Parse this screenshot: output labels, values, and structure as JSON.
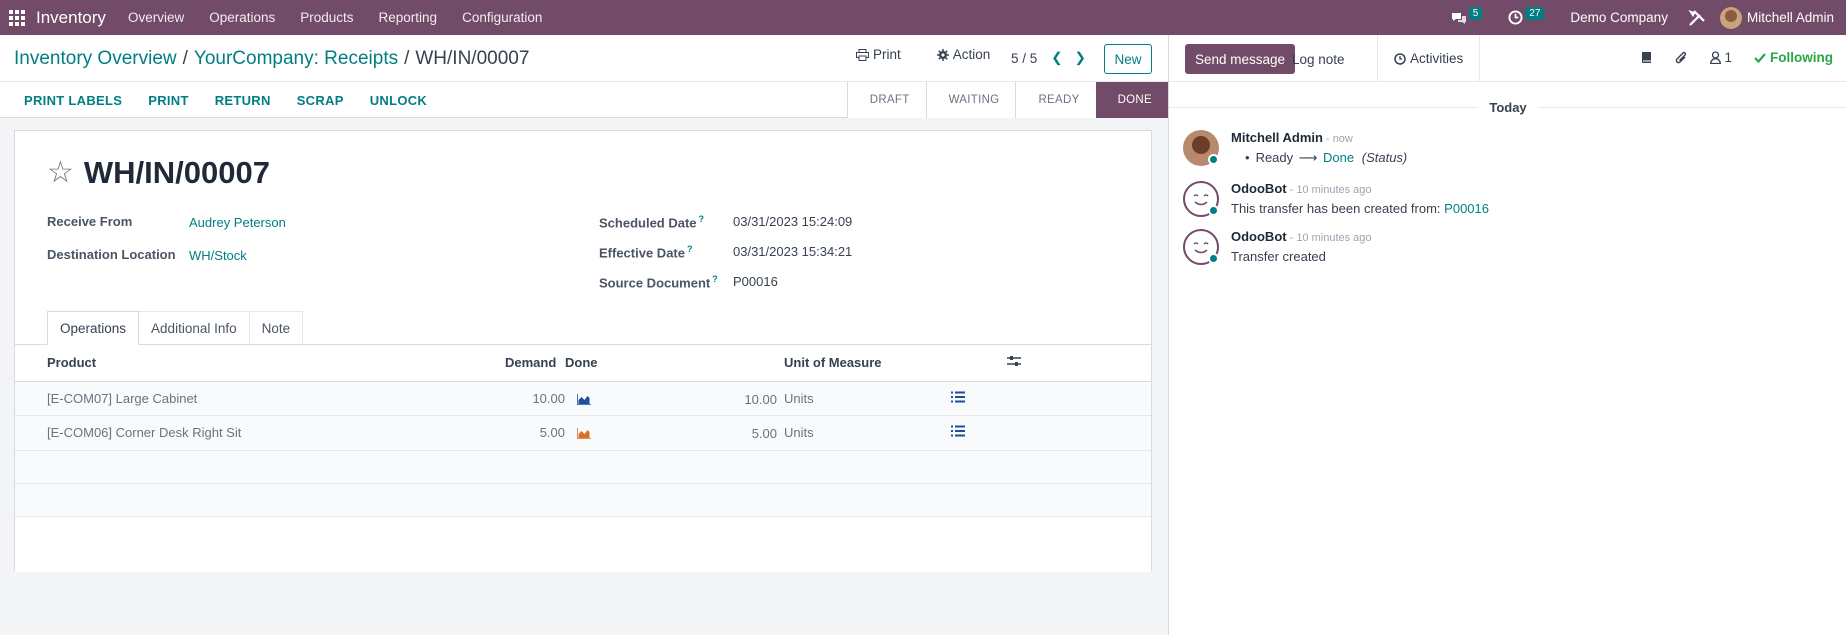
{
  "navbar": {
    "app_name": "Inventory",
    "menu": [
      "Overview",
      "Operations",
      "Products",
      "Reporting",
      "Configuration"
    ],
    "messages_count": "5",
    "activities_count": "27",
    "company": "Demo Company",
    "user": "Mitchell Admin"
  },
  "breadcrumb": {
    "items": [
      "Inventory Overview",
      "YourCompany: Receipts"
    ],
    "current": "WH/IN/00007"
  },
  "control_panel": {
    "print_label": "Print",
    "action_label": "Action",
    "pager": "5 / 5",
    "new_label": "New"
  },
  "status_buttons": [
    "PRINT LABELS",
    "PRINT",
    "RETURN",
    "SCRAP",
    "UNLOCK"
  ],
  "stages": [
    "DRAFT",
    "WAITING",
    "READY",
    "DONE"
  ],
  "record": {
    "title": "WH/IN/00007",
    "receive_from_label": "Receive From",
    "receive_from": "Audrey Peterson",
    "destination_label": "Destination Location",
    "destination": "WH/Stock",
    "scheduled_date_label": "Scheduled Date",
    "scheduled_date": "03/31/2023 15:24:09",
    "effective_date_label": "Effective Date",
    "effective_date": "03/31/2023 15:34:21",
    "source_document_label": "Source Document",
    "source_document": "P00016"
  },
  "tabs": [
    "Operations",
    "Additional Info",
    "Note"
  ],
  "lines": {
    "headers": {
      "product": "Product",
      "demand": "Demand",
      "done": "Done",
      "uom": "Unit of Measure"
    },
    "rows": [
      {
        "product": "[E-COM07] Large Cabinet",
        "demand": "10.00",
        "done": "10.00",
        "uom": "Units"
      },
      {
        "product": "[E-COM06] Corner Desk Right Sit",
        "demand": "5.00",
        "done": "5.00",
        "uom": "Units"
      }
    ]
  },
  "chatter": {
    "send_message": "Send message",
    "log_note": "Log note",
    "activities": "Activities",
    "followers_count": "1",
    "following": "Following",
    "date_separator": "Today",
    "messages": [
      {
        "author": "Mitchell Admin",
        "time": "- now",
        "from_state": "Ready",
        "to_state": "Done",
        "field": "(Status)"
      },
      {
        "author": "OdooBot",
        "time": "- 10 minutes ago",
        "text": "This transfer has been created from:",
        "link": "P00016"
      },
      {
        "author": "OdooBot",
        "time": "- 10 minutes ago",
        "text": "Transfer created"
      }
    ]
  },
  "colors": {
    "brand": "#714b67",
    "accent": "#017e84",
    "following": "#28a745"
  }
}
